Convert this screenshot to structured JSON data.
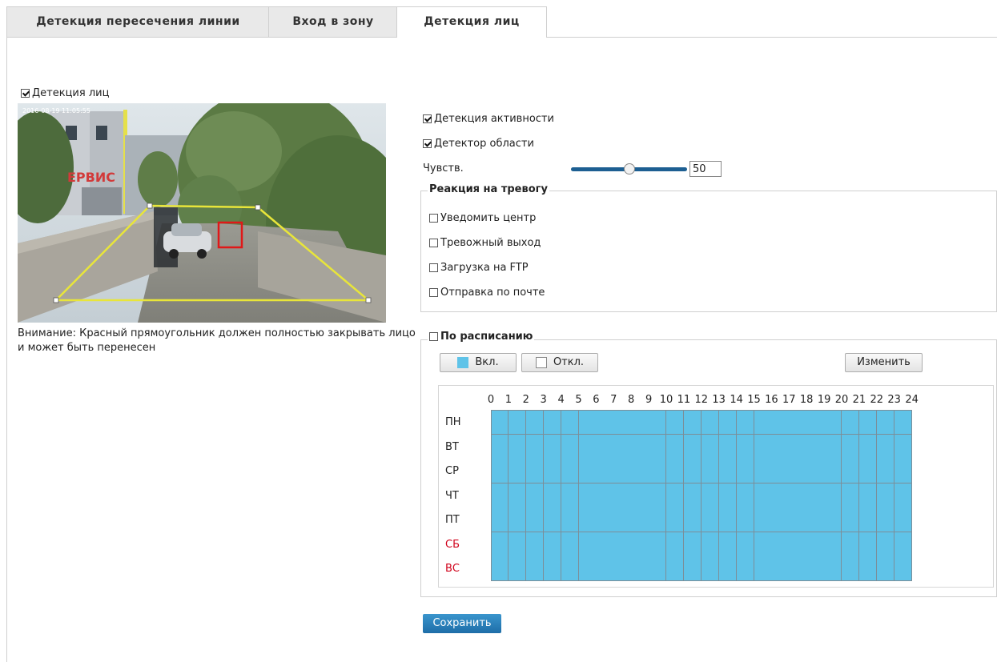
{
  "tabs": [
    {
      "label": "Детекция пересечения линии",
      "active": false
    },
    {
      "label": "Вход в зону",
      "active": false
    },
    {
      "label": "Детекция лиц",
      "active": true
    }
  ],
  "face_detection": {
    "label": "Детекция лиц",
    "checked": true
  },
  "preview": {
    "overlay_text": "2016-08-19 11:05:55",
    "sign_text": "ЕРВИС"
  },
  "warning": "Внимание: Красный прямоугольник должен полностью закрывать лицо и может быть перенесен",
  "activity_detection": {
    "label": "Детекция активности",
    "checked": true
  },
  "area_detector": {
    "label": "Детектор области",
    "checked": true
  },
  "sensitivity": {
    "label": "Чувств.",
    "value": "50",
    "fraction": 0.5
  },
  "alarm_reaction": {
    "legend": "Реакция на тревогу",
    "options": [
      {
        "label": "Уведомить центр",
        "checked": false
      },
      {
        "label": "Тревожный выход",
        "checked": false
      },
      {
        "label": "Загрузка на FTP",
        "checked": false
      },
      {
        "label": "Отправка по почте",
        "checked": false
      }
    ]
  },
  "schedule": {
    "legend": "По расписанию",
    "checked": false,
    "on_button": "Вкл.",
    "off_button": "Откл.",
    "edit_button": "Изменить",
    "hours": [
      "0",
      "1",
      "2",
      "3",
      "4",
      "5",
      "6",
      "7",
      "8",
      "9",
      "10",
      "11",
      "12",
      "13",
      "14",
      "15",
      "16",
      "17",
      "18",
      "19",
      "20",
      "21",
      "22",
      "23",
      "24"
    ],
    "days": [
      {
        "label": "ПН",
        "weekend": false
      },
      {
        "label": "ВТ",
        "weekend": false
      },
      {
        "label": "СР",
        "weekend": false
      },
      {
        "label": "ЧТ",
        "weekend": false
      },
      {
        "label": "ПТ",
        "weekend": false
      },
      {
        "label": "СБ",
        "weekend": true
      },
      {
        "label": "ВС",
        "weekend": true
      }
    ],
    "on_color": "#5fc3e8",
    "weekend_color": "#d0021b"
  },
  "save_button": "Сохранить"
}
